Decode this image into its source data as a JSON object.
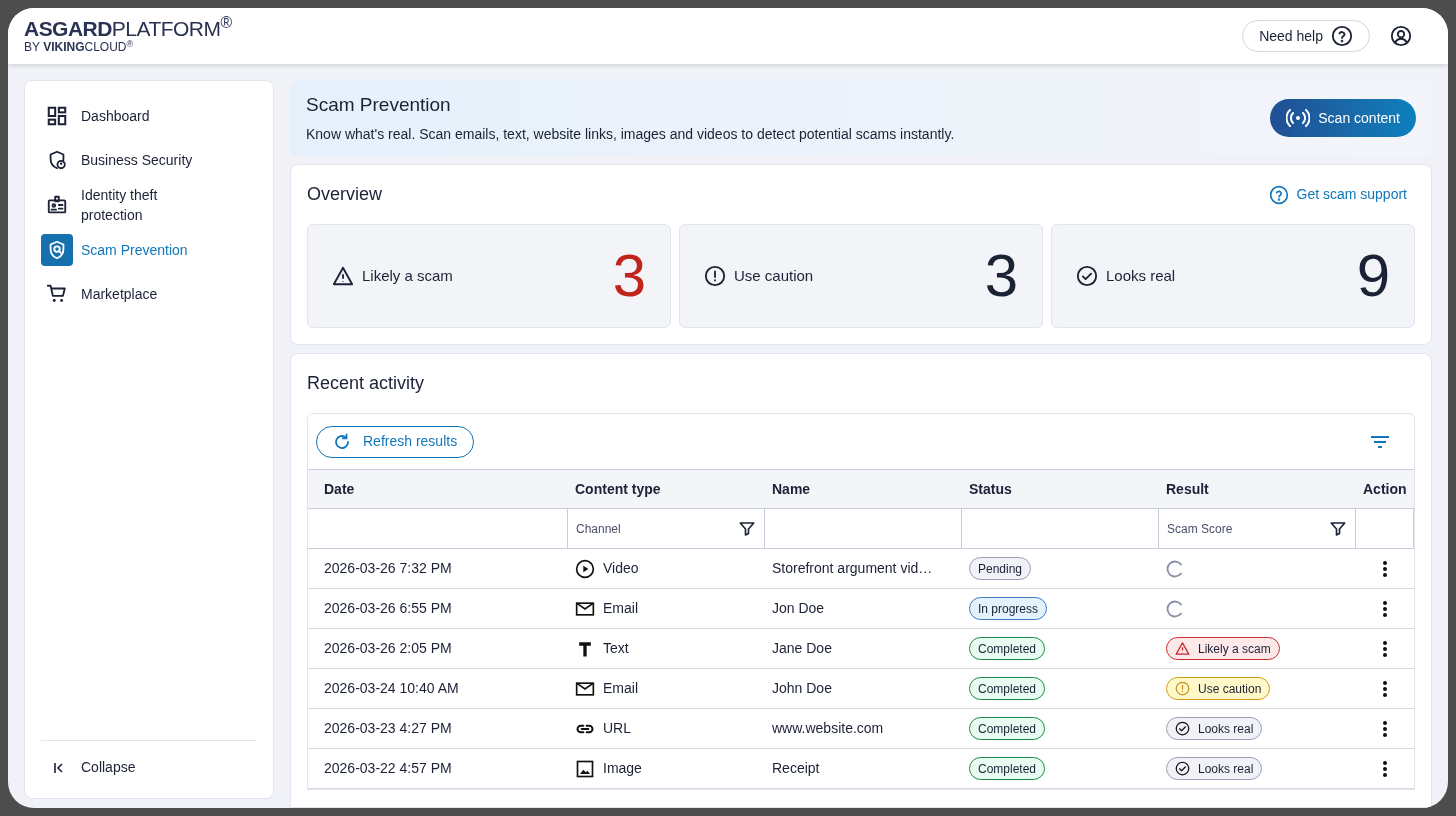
{
  "header": {
    "logo_line_1": "**ASGARD**PLATFORM$^{®}$",
    "logo_line_2": "BY **VIKING**CLOUD$^{®}$",
    "help_button": "Need help"
  },
  "sidebar": {
    "items": [
      {
        "label": "Dashboard",
        "selected": false
      },
      {
        "label": "Business Security",
        "selected": false
      },
      {
        "label": "Identity theft protection",
        "selected": false
      },
      {
        "label": "Scam Prevention",
        "selected": true
      },
      {
        "label": "Marketplace",
        "selected": false
      }
    ],
    "collapse": "Collapse"
  },
  "banner": {
    "title": "Scam Prevention",
    "subtitle": "Know what's real. Scan emails, text, website links, images and videos to detect potential scams instantly.",
    "button": "Scan content"
  },
  "overview": {
    "title": "Overview",
    "support_link": "Get scam support",
    "cards": [
      {
        "kind": "scam",
        "label": "Likely a scam",
        "count": "3"
      },
      {
        "kind": "caution",
        "label": "Use caution",
        "count": "3"
      },
      {
        "kind": "real",
        "label": "Looks real",
        "count": "9"
      }
    ]
  },
  "recent_activity": {
    "title": "Recent activity",
    "refresh_button": "Refresh results",
    "columns": [
      "Date",
      "Content type",
      "Name",
      "Status",
      "Result",
      "Action"
    ],
    "filters": {
      "channel": "Channel",
      "scam_score": "Scam Score"
    },
    "rows": [
      {
        "date": "2026-03-26 7:32 PM",
        "type": {
          "kind": "video",
          "label": "Video"
        },
        "name": "Storefront argument vid…",
        "status": {
          "kind": "pending",
          "label": "Pending"
        },
        "result": {
          "kind": "loading"
        }
      },
      {
        "date": "2026-03-26 6:55 PM",
        "type": {
          "kind": "email",
          "label": "Email"
        },
        "name": "Jon Doe",
        "status": {
          "kind": "progress",
          "label": "In progress"
        },
        "result": {
          "kind": "loading"
        }
      },
      {
        "date": "2026-03-26 2:05 PM",
        "type": {
          "kind": "text",
          "label": "Text"
        },
        "name": "Jane Doe",
        "status": {
          "kind": "completed",
          "label": "Completed"
        },
        "result": {
          "kind": "scam",
          "label": "Likely a scam"
        }
      },
      {
        "date": "2026-03-24 10:40 AM",
        "type": {
          "kind": "email",
          "label": "Email"
        },
        "name": "John Doe",
        "status": {
          "kind": "completed",
          "label": "Completed"
        },
        "result": {
          "kind": "caution",
          "label": "Use caution"
        }
      },
      {
        "date": "2026-03-23 4:27 PM",
        "type": {
          "kind": "url",
          "label": "URL"
        },
        "name": "www.website.com",
        "status": {
          "kind": "completed",
          "label": "Completed"
        },
        "result": {
          "kind": "real",
          "label": "Looks real"
        }
      },
      {
        "date": "2026-03-22 4:57 PM",
        "type": {
          "kind": "image",
          "label": "Image"
        },
        "name": "Receipt",
        "status": {
          "kind": "completed",
          "label": "Completed"
        },
        "result": {
          "kind": "real",
          "label": "Looks real"
        }
      }
    ]
  }
}
